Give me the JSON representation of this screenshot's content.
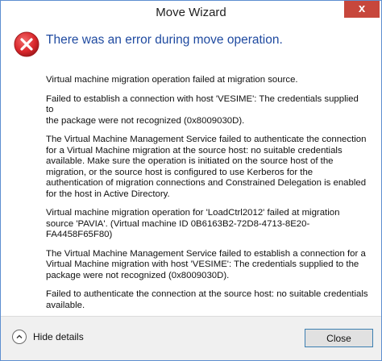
{
  "window": {
    "title": "Move Wizard",
    "close_glyph": "x"
  },
  "dialog": {
    "icon": "error-icon",
    "heading": "There was an error during move operation.",
    "paragraphs": [
      "Virtual machine migration operation failed at migration source.",
      "Failed to establish a connection with host 'VESIME': The credentials supplied to\nthe package were not recognized (0x8009030D).",
      "The Virtual Machine Management Service failed to authenticate the connection\nfor a Virtual Machine migration at the source host: no suitable credentials\navailable. Make sure the operation is initiated on the source host of the\nmigration, or the source host is configured to use Kerberos for the\nauthentication of migration connections and Constrained Delegation is enabled\nfor the host in Active Directory.",
      "Virtual machine migration operation for 'LoadCtrl2012' failed at migration\nsource 'PAVIA'. (Virtual machine ID 0B6163B2-72D8-4713-8E20-FA4458F65F80)",
      "The Virtual Machine Management Service failed to establish a connection for a\nVirtual Machine migration with host 'VESIME': The credentials supplied to the\npackage were not recognized (0x8009030D).",
      "Failed to authenticate the connection at the source host: no suitable credentials\navailable."
    ]
  },
  "footer": {
    "details_label": "Hide details",
    "close_label": "Close"
  },
  "colors": {
    "heading": "#1f4aa0",
    "error_red": "#d9262b",
    "close_x_bg": "#c7473c",
    "button_border": "#3c7fb1"
  }
}
